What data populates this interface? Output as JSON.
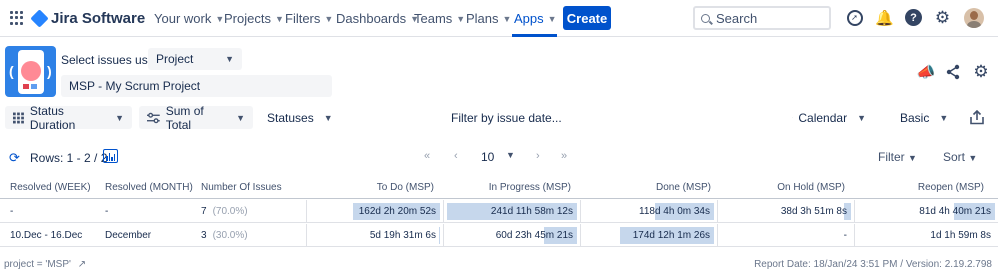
{
  "topnav": {
    "product": "Jira Software",
    "items": [
      {
        "label": "Your work",
        "chevron": true
      },
      {
        "label": "Projects",
        "chevron": true
      },
      {
        "label": "Filters",
        "chevron": true
      },
      {
        "label": "Dashboards",
        "chevron": true
      },
      {
        "label": "Teams",
        "chevron": true
      },
      {
        "label": "Plans",
        "chevron": true
      },
      {
        "label": "Apps",
        "chevron": true,
        "active": true
      }
    ],
    "create_label": "Create",
    "search_placeholder": "Search",
    "accent_color": "#0052cc"
  },
  "header": {
    "select_label": "Select issues using",
    "select_mode": "Project",
    "project": "MSP - My Scrum Project"
  },
  "toolbar": {
    "status_duration": "Status Duration",
    "sum_of_total": "Sum of Total",
    "statuses": "Statuses",
    "filter_by_date": "Filter by issue date...",
    "calendar": "Calendar",
    "basic": "Basic"
  },
  "rowsbar": {
    "rows_label": "Rows: 1 - 2 / 2",
    "page_size": "10",
    "filter": "Filter",
    "sort": "Sort"
  },
  "table": {
    "columns": [
      "Resolved (WEEK)",
      "Resolved (MONTH)",
      "Number Of Issues",
      "To Do (MSP)",
      "In Progress (MSP)",
      "Done (MSP)",
      "On Hold (MSP)",
      "Reopen (MSP)"
    ],
    "rows": [
      {
        "week": "-",
        "month": "-",
        "count": "7",
        "pct": "(70.0%)",
        "cells": [
          {
            "value": "162d 2h 20m 52s",
            "fill": 0.67
          },
          {
            "value": "241d 11h 58m 12s",
            "fill": 1.0
          },
          {
            "value": "118d 4h 0m 34s",
            "fill": 0.45
          },
          {
            "value": "38d 3h 51m 8s",
            "fill": 0.05
          },
          {
            "value": "81d 4h 40m 21s",
            "fill": 0.3
          }
        ]
      },
      {
        "week": "10.Dec - 16.Dec",
        "month": "December",
        "count": "3",
        "pct": "(30.0%)",
        "cells": [
          {
            "value": "5d 19h 31m 6s",
            "fill": 0.01
          },
          {
            "value": "60d 23h 45m 21s",
            "fill": 0.25
          },
          {
            "value": "174d 12h 1m 26s",
            "fill": 0.72
          },
          {
            "value": "-",
            "fill": 0
          },
          {
            "value": "1d 1h 59m 8s",
            "fill": 0
          }
        ]
      }
    ]
  },
  "footer": {
    "query": "project = 'MSP'",
    "report": "Report Date: 18/Jan/24 3:51 PM / Version: 2.19.2.798"
  }
}
